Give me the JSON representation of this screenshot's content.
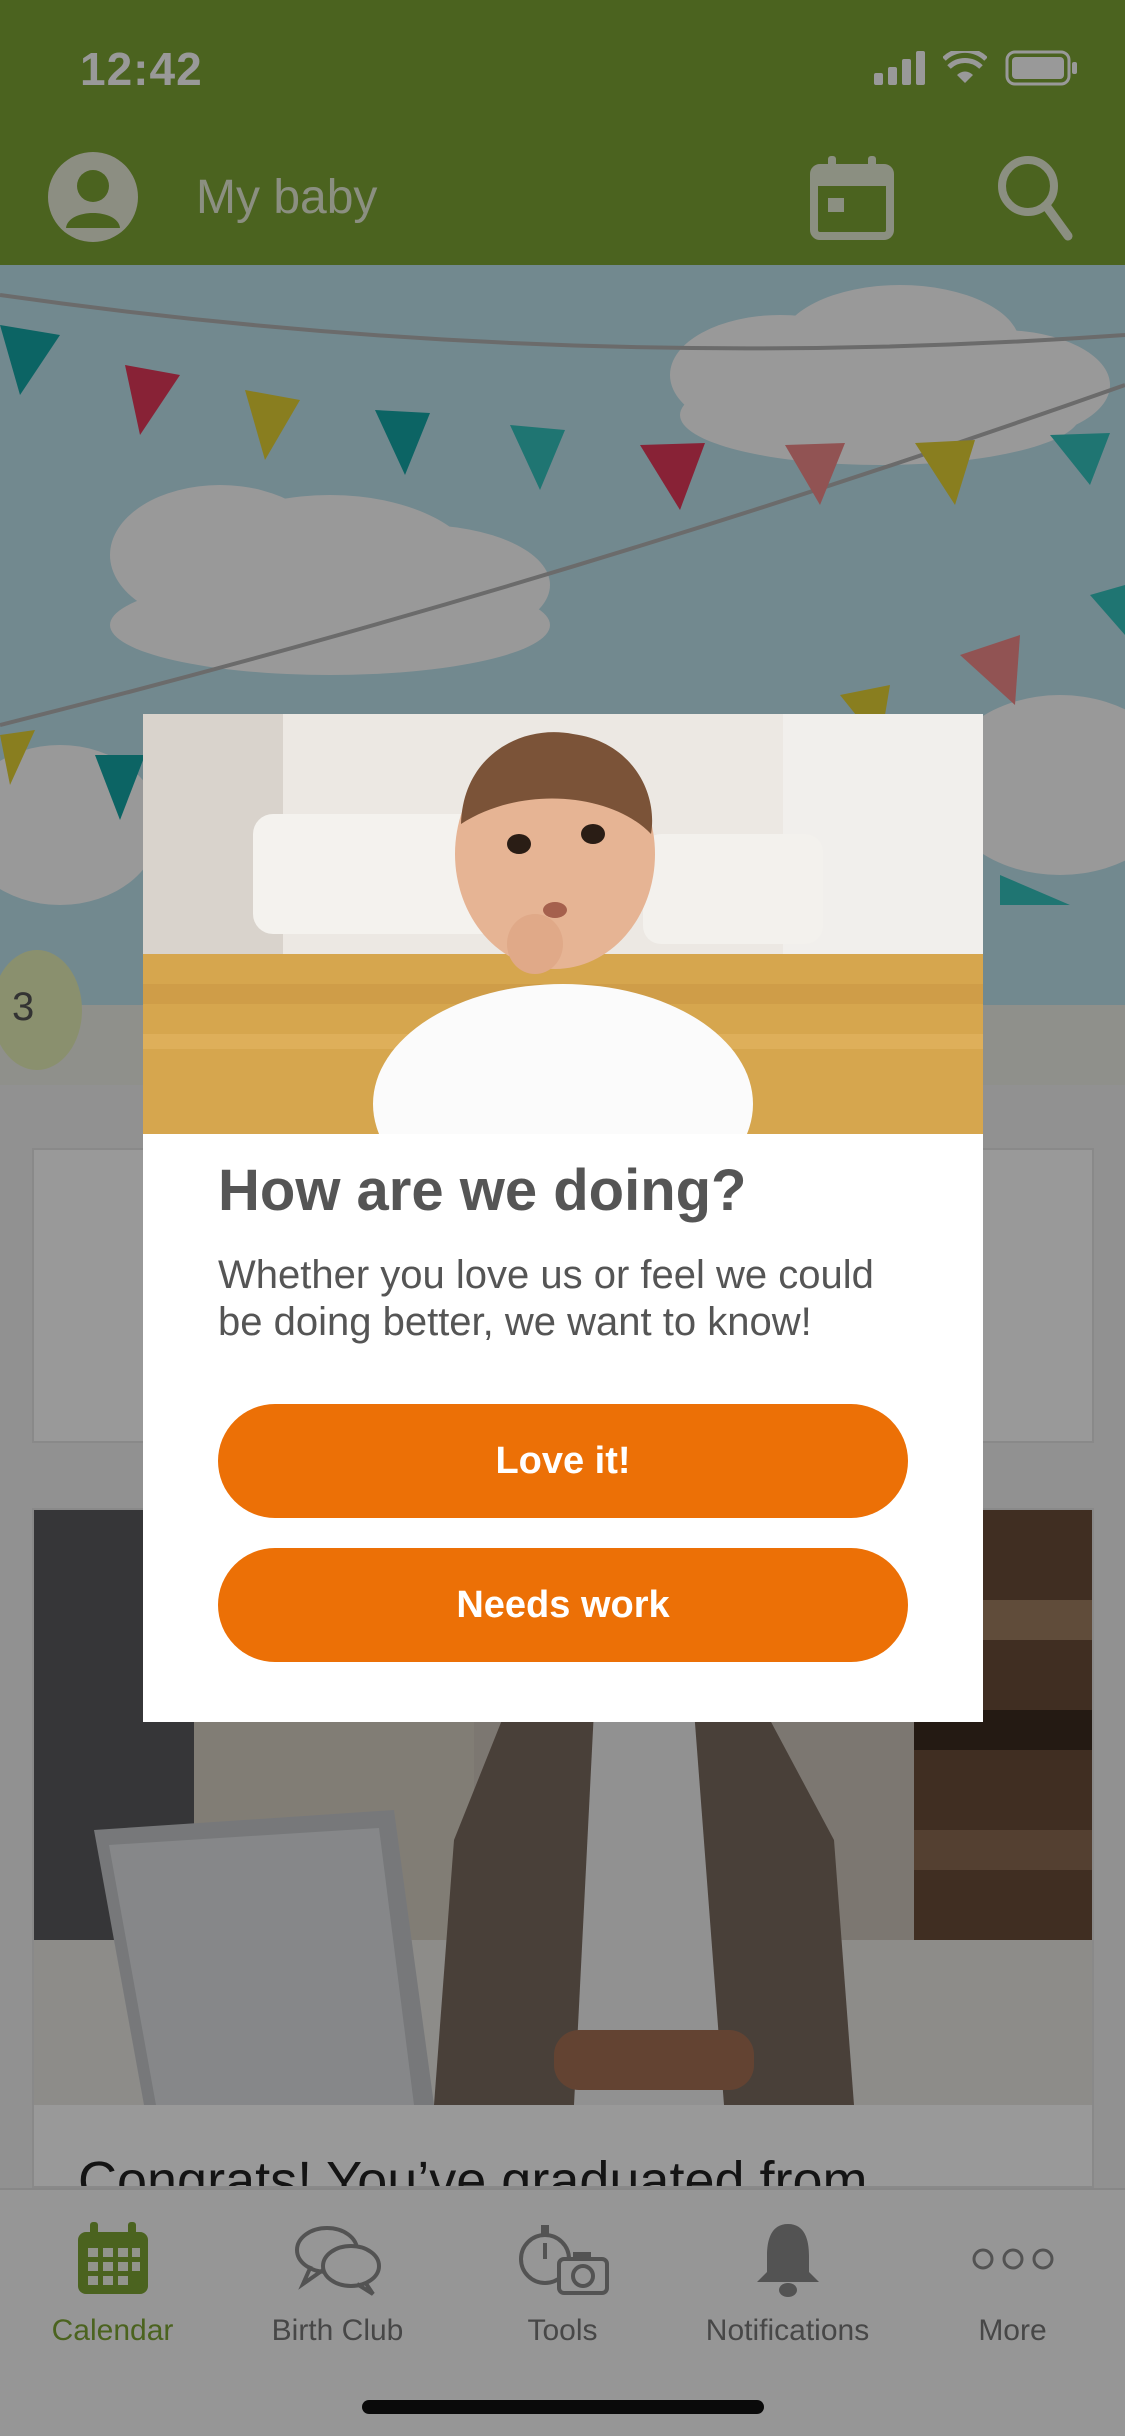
{
  "status_bar": {
    "time": "12:42"
  },
  "header": {
    "title": "My baby"
  },
  "banner": {
    "badge": "3"
  },
  "feed": {
    "card_title": "Congrats! You’ve graduated from"
  },
  "modal": {
    "title": "How are we doing?",
    "body": "Whether you love us or feel we could be doing better, we want to know!",
    "primary_button": "Love it!",
    "secondary_button": "Needs work"
  },
  "tabbar": {
    "items": [
      {
        "label": "Calendar",
        "icon": "calendar-icon",
        "active": true
      },
      {
        "label": "Birth Club",
        "icon": "chat-bubbles-icon",
        "active": false
      },
      {
        "label": "Tools",
        "icon": "tools-icon",
        "active": false
      },
      {
        "label": "Notifications",
        "icon": "bell-icon",
        "active": false
      },
      {
        "label": "More",
        "icon": "more-dots-icon",
        "active": false
      }
    ]
  },
  "colors": {
    "brand_green": "#7da534",
    "button_orange": "#ec7006",
    "banner_sky": "#bfe4ee"
  }
}
